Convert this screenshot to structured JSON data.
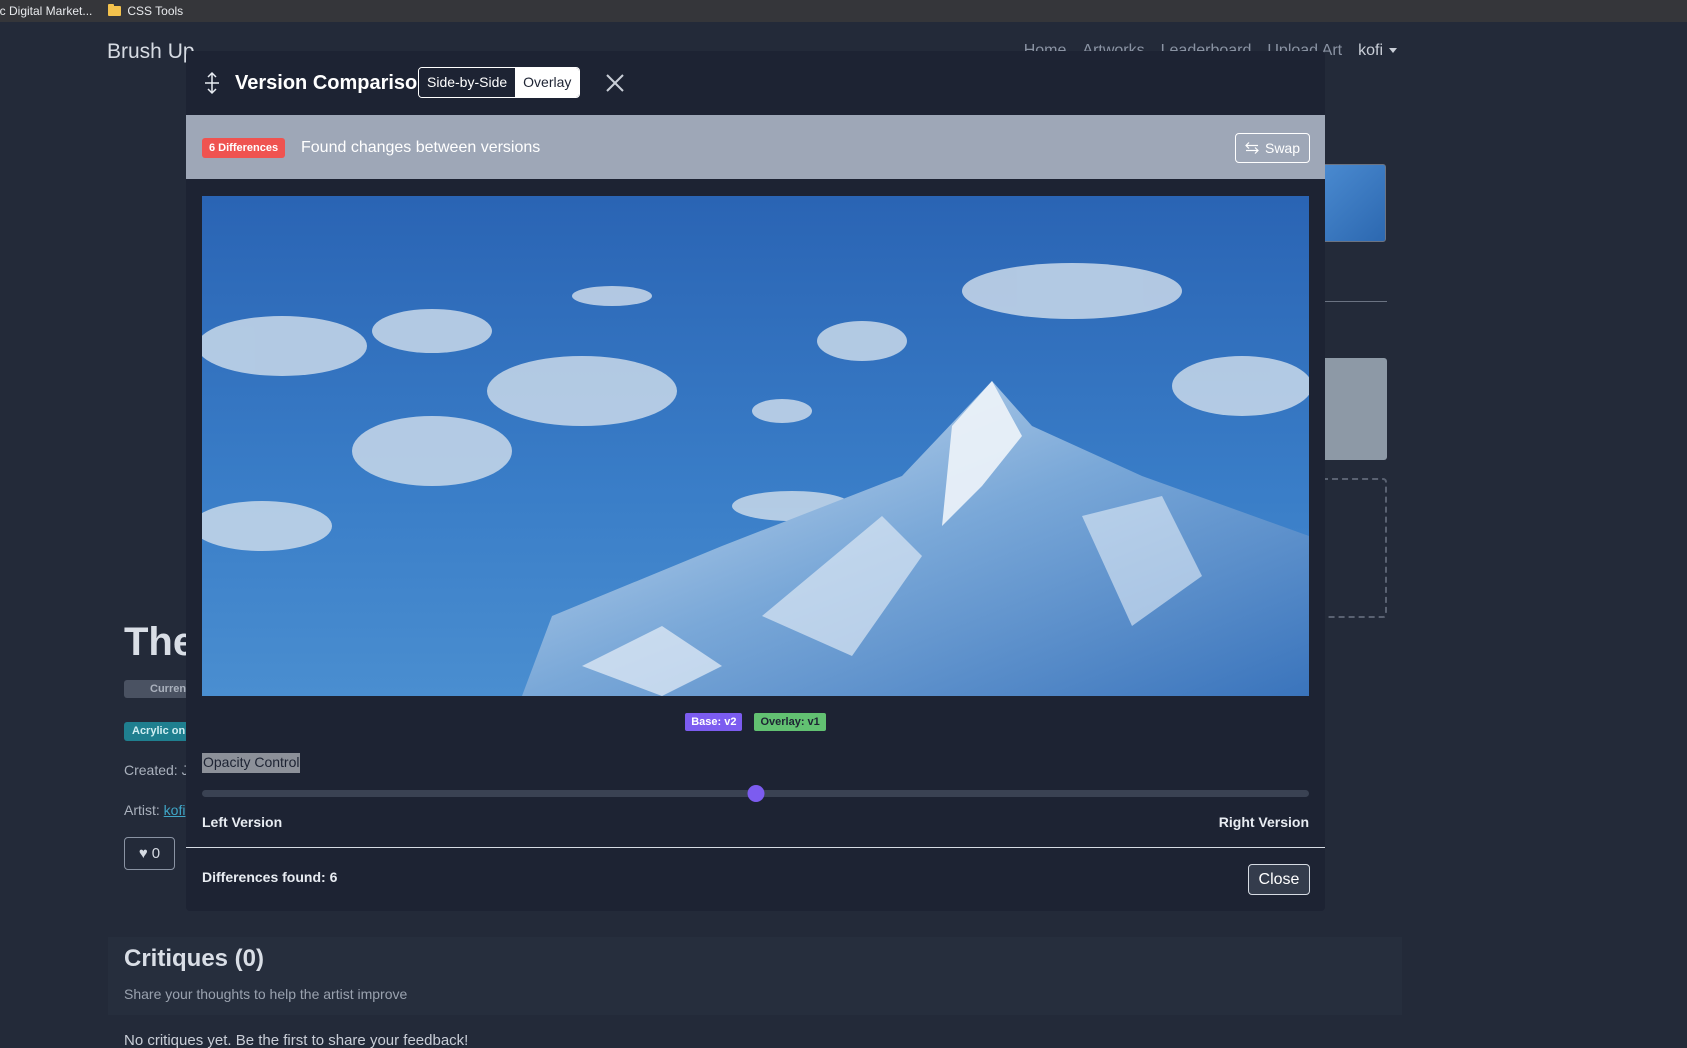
{
  "bookmarks": [
    {
      "label": "ic Digital Market..."
    },
    {
      "label": "CSS Tools",
      "icon": "folder-icon"
    }
  ],
  "navbar": {
    "brand": "Brush Up",
    "links": [
      "Home",
      "Artworks",
      "Leaderboard",
      "Upload Art"
    ],
    "user": "kofi"
  },
  "background": {
    "title": "The",
    "badge_current": "Curren",
    "badge_medium": "Acrylic on",
    "created": "Created: J",
    "artist_label": "Artist: ",
    "artist_link": "kofi",
    "likes": "0",
    "critiques_title": "Critiques (0)",
    "critiques_subtitle": "Share your thoughts to help the artist improve",
    "no_critiques": "No critiques yet. Be the first to share your feedback!"
  },
  "modal": {
    "title": "Version Comparison",
    "view_modes": [
      "Side-by-Side",
      "Overlay"
    ],
    "active_view_mode": "Side-by-Side",
    "diff_badge": "6 Differences",
    "info_text": "Found changes between versions",
    "swap_label": "Swap",
    "base_label": "Base: v2",
    "overlay_label": "Overlay: v1",
    "opacity_label": "Opacity Control",
    "opacity_value": 0.5,
    "left_version_label": "Left Version",
    "right_version_label": "Right Version",
    "differences_found": "Differences found: 6",
    "close_label": "Close"
  },
  "colors": {
    "diff_badge": "#ef5350",
    "base_badge": "#7c5cf0",
    "overlay_badge": "#62c172",
    "info_bar": "#9ea7b7",
    "modal_bg": "#1d2333"
  }
}
